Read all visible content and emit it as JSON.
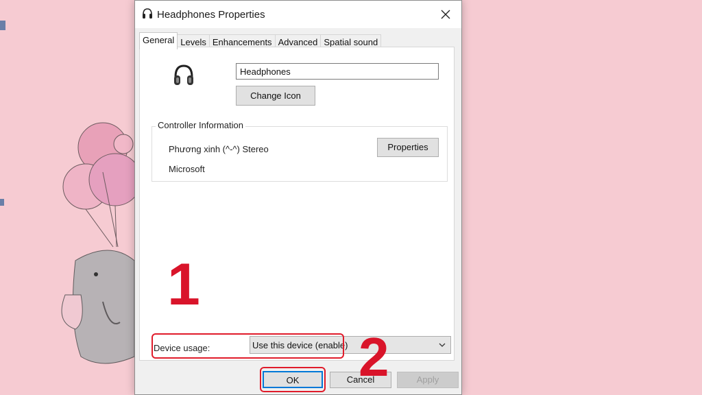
{
  "dialog": {
    "title": "Headphones Properties",
    "tabs": [
      {
        "label": "General",
        "active": true
      },
      {
        "label": "Levels",
        "active": false
      },
      {
        "label": "Enhancements",
        "active": false
      },
      {
        "label": "Advanced",
        "active": false
      },
      {
        "label": "Spatial sound",
        "active": false
      }
    ],
    "device_name": "Headphones",
    "change_icon_label": "Change Icon",
    "controller": {
      "group_label": "Controller Information",
      "name": "Phương xinh (^-^) Stereo",
      "vendor": "Microsoft",
      "properties_label": "Properties"
    },
    "device_usage": {
      "label": "Device usage:",
      "value": "Use this device (enable)"
    },
    "buttons": {
      "ok": "OK",
      "cancel": "Cancel",
      "apply": "Apply"
    }
  },
  "annotations": {
    "step1": "1",
    "step2": "2",
    "highlight_color": "#e01b2a"
  },
  "icons": {
    "title": "headphones-icon",
    "device": "headphones-icon",
    "close": "close-icon",
    "dropdown": "chevron-down-icon"
  },
  "colors": {
    "wallpaper": "#f6cbd2",
    "focus_border": "#0078d7"
  }
}
